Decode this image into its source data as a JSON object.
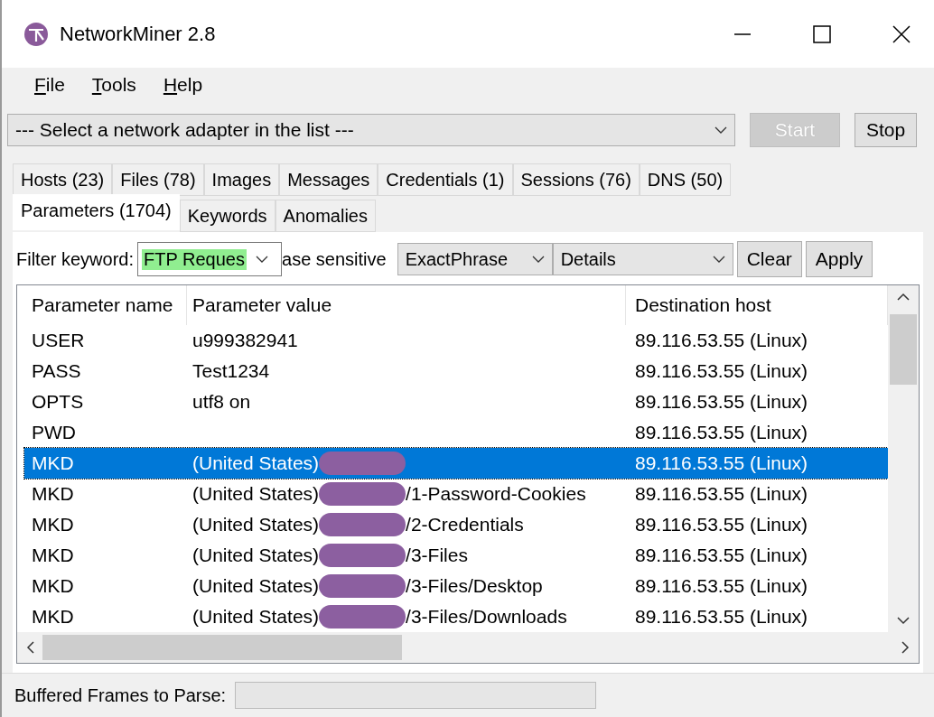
{
  "window": {
    "title": "NetworkMiner 2.8"
  },
  "menu": [
    {
      "label": "File"
    },
    {
      "label": "Tools"
    },
    {
      "label": "Help"
    }
  ],
  "adapter": {
    "value": "--- Select a network adapter in the list ---"
  },
  "buttons": [
    {
      "label": "Start",
      "disabled": true
    },
    {
      "label": "Stop",
      "disabled": false
    }
  ],
  "tabs_row1": [
    {
      "label": "Hosts (23)",
      "selected": false
    },
    {
      "label": "Files (78)",
      "selected": false
    },
    {
      "label": "Images",
      "selected": false
    },
    {
      "label": "Messages",
      "selected": false
    },
    {
      "label": "Credentials (1)",
      "selected": false
    },
    {
      "label": "Sessions (76)",
      "selected": false
    },
    {
      "label": "DNS (50)",
      "selected": false
    }
  ],
  "tabs_row2": [
    {
      "label": "Parameters (1704)",
      "selected": true
    },
    {
      "label": "Keywords",
      "selected": false
    },
    {
      "label": "Anomalies",
      "selected": false
    }
  ],
  "filter": {
    "label": "Filter keyword:",
    "value": "FTP Reques",
    "case_label": "ase sensitive",
    "mode": "ExactPhrase",
    "scope": "Details",
    "clear": "Clear",
    "apply": "Apply"
  },
  "table": {
    "columns": [
      "Parameter name",
      "Parameter value",
      "Destination host"
    ],
    "rows": [
      {
        "name": "USER",
        "value": "u999382941",
        "redacted": false,
        "suffix": "",
        "host": "89.116.53.55 (Linux)",
        "selected": false
      },
      {
        "name": "PASS",
        "value": "Test1234",
        "redacted": false,
        "suffix": "",
        "host": "89.116.53.55 (Linux)",
        "selected": false
      },
      {
        "name": "OPTS",
        "value": "utf8 on",
        "redacted": false,
        "suffix": "",
        "host": "89.116.53.55 (Linux)",
        "selected": false
      },
      {
        "name": "PWD",
        "value": "",
        "redacted": false,
        "suffix": "",
        "host": "89.116.53.55 (Linux)",
        "selected": false
      },
      {
        "name": "MKD",
        "value": "(United States)",
        "redacted": true,
        "suffix": "",
        "host": "89.116.53.55 (Linux)",
        "selected": true
      },
      {
        "name": "MKD",
        "value": "(United States)",
        "redacted": true,
        "suffix": "/1-Password-Cookies",
        "host": "89.116.53.55 (Linux)",
        "selected": false
      },
      {
        "name": "MKD",
        "value": "(United States)",
        "redacted": true,
        "suffix": "/2-Credentials",
        "host": "89.116.53.55 (Linux)",
        "selected": false
      },
      {
        "name": "MKD",
        "value": "(United States)",
        "redacted": true,
        "suffix": "/3-Files",
        "host": "89.116.53.55 (Linux)",
        "selected": false
      },
      {
        "name": "MKD",
        "value": "(United States)",
        "redacted": true,
        "suffix": "/3-Files/Desktop",
        "host": "89.116.53.55 (Linux)",
        "selected": false
      },
      {
        "name": "MKD",
        "value": "(United States)",
        "redacted": true,
        "suffix": "/3-Files/Downloads",
        "host": "89.116.53.55 (Linux)",
        "selected": false
      }
    ]
  },
  "status_bar": {
    "label": "Buffered Frames to Parse:",
    "level": 0
  }
}
